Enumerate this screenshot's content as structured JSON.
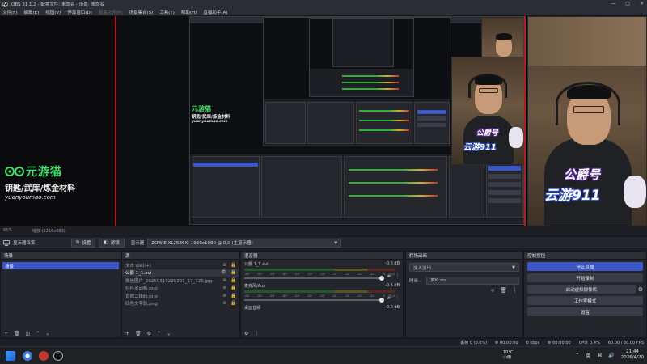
{
  "window": {
    "title": "OBS 31.1.2 - 配置文件: 未命名 - 场景: 未命名",
    "controls": [
      "—",
      "▢",
      "✕"
    ]
  },
  "menu": [
    {
      "label": "文件(F)",
      "disabled": false
    },
    {
      "label": "编辑(E)",
      "disabled": false
    },
    {
      "label": "视图(V)",
      "disabled": false
    },
    {
      "label": "停靠窗口(D)",
      "disabled": false
    },
    {
      "label": "配置文件(P)",
      "disabled": true
    },
    {
      "label": "场景集合(S)",
      "disabled": false
    },
    {
      "label": "工具(T)",
      "disabled": false
    },
    {
      "label": "帮助(H)",
      "disabled": false
    },
    {
      "label": "直播助手(A)",
      "disabled": false
    }
  ],
  "overlay": {
    "brand": "元游猫",
    "subtitle": "钥匙/武库/炼金材料",
    "url": "yuanyoumao.com",
    "cam_caption_1": "公爵号",
    "cam_caption_2": "云游911"
  },
  "preview_status": {
    "zoom": "65%",
    "canvas_size": "缩放 (1216x683)"
  },
  "source_toolbar": {
    "source_name": "显示器采集",
    "settings_label": "设置",
    "filters_label": "滤镜",
    "display_label": "显示器",
    "display_value": "ZOWIE XL2586X: 1920x1080 @ 0,0 (主显示器)"
  },
  "docks": {
    "scenes": {
      "title": "场景",
      "items": [
        "场景"
      ]
    },
    "sources": {
      "title": "源",
      "items": [
        {
          "label": "文本 (GDI+)",
          "selected": false
        },
        {
          "label": "公爵 1_1.avi",
          "selected": true
        },
        {
          "label": "微信图片_20250319225201_17_126.jpg",
          "selected": false
        },
        {
          "label": "抖抖灵动板.png",
          "selected": false
        },
        {
          "label": "直播二维码.png",
          "selected": false
        },
        {
          "label": "红色文字轨.png",
          "selected": false
        }
      ]
    },
    "mixer": {
      "title": "混音器",
      "channels": [
        {
          "name": "公爵 1_1.avi",
          "db": "-0.6 dB",
          "live": true
        },
        {
          "name": "麦克风/Aux",
          "db": "-0.6 dB",
          "live": false
        },
        {
          "name": "桌面音频",
          "db": "-0.0 dB",
          "live": false
        }
      ],
      "ticks": [
        "-60",
        "-55",
        "-50",
        "-45",
        "-40",
        "-35",
        "-30",
        "-25",
        "-20",
        "-15",
        "-10",
        "-5",
        "0"
      ]
    },
    "transitions": {
      "title": "转场动画",
      "selected": "淡入淡出",
      "duration_label": "时长",
      "duration_value": "300 ms"
    },
    "controls": {
      "title": "控制按钮",
      "buttons": [
        "停止直播",
        "开始录制",
        "启动虚拟摄像机",
        "工作室模式",
        "设置"
      ]
    }
  },
  "statusbar": {
    "dropped": "丢帧 0 (0.0%)",
    "time1": "00:00:00",
    "bitrate": "0 kbps",
    "time2": "00:00:00",
    "cpu": "CPU: 0.4%",
    "fps": "60.00 / 60.00 FPS"
  },
  "taskbar": {
    "weather_temp": "10°C",
    "weather_desc": "小雨",
    "ime": "英",
    "time": "21:44",
    "date": "2026/4/20"
  },
  "colors": {
    "accent": "#3c56c8",
    "live_border": "#c01818",
    "brand_green": "#3fe06a"
  }
}
